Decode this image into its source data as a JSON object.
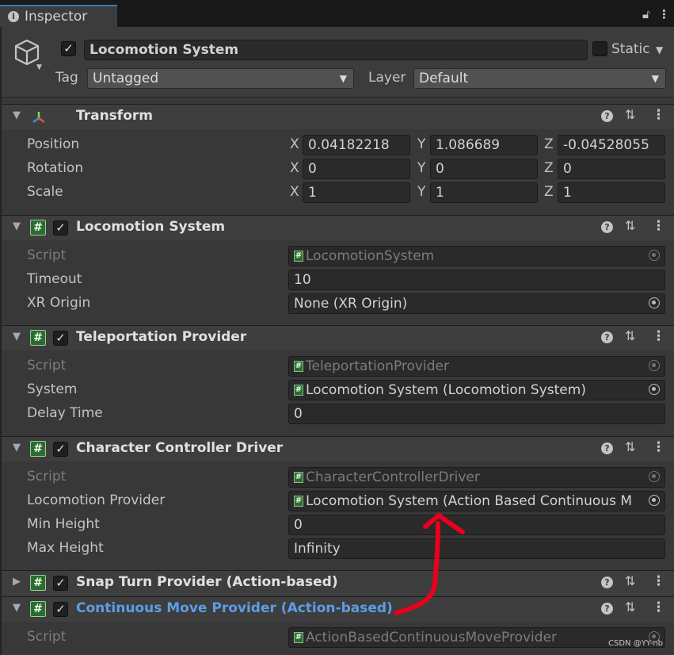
{
  "window": {
    "tab_title": "Inspector",
    "tab_icon": "info-icon"
  },
  "object": {
    "name": "Locomotion System",
    "active": true,
    "static_label": "Static",
    "static_checked": false,
    "tag_label": "Tag",
    "tag_value": "Untagged",
    "layer_label": "Layer",
    "layer_value": "Default"
  },
  "transform": {
    "title": "Transform",
    "position": {
      "label": "Position",
      "x": "0.04182218",
      "y": "1.086689",
      "z": "-0.04528055"
    },
    "rotation": {
      "label": "Rotation",
      "x": "0",
      "y": "0",
      "z": "0"
    },
    "scale": {
      "label": "Scale",
      "x": "1",
      "y": "1",
      "z": "1"
    },
    "axis": {
      "x": "X",
      "y": "Y",
      "z": "Z"
    }
  },
  "locomotion_system": {
    "title": "Locomotion System",
    "script_label": "Script",
    "script_value": "LocomotionSystem",
    "timeout_label": "Timeout",
    "timeout_value": "10",
    "xr_origin_label": "XR Origin",
    "xr_origin_value": "None (XR Origin)"
  },
  "teleportation_provider": {
    "title": "Teleportation Provider",
    "script_label": "Script",
    "script_value": "TeleportationProvider",
    "system_label": "System",
    "system_value": "Locomotion System (Locomotion System)",
    "delay_label": "Delay Time",
    "delay_value": "0"
  },
  "character_controller_driver": {
    "title": "Character Controller Driver",
    "script_label": "Script",
    "script_value": "CharacterControllerDriver",
    "provider_label": "Locomotion Provider",
    "provider_value": "Locomotion System (Action Based Continuous M",
    "min_label": "Min Height",
    "min_value": "0",
    "max_label": "Max Height",
    "max_value": "Infinity"
  },
  "snap_turn_provider": {
    "title": "Snap Turn Provider (Action-based)"
  },
  "continuous_move_provider": {
    "title": "Continuous Move Provider (Action-based)",
    "script_label": "Script",
    "script_value": "ActionBasedContinuousMoveProvider"
  },
  "colors": {
    "highlight_title": "#5c9ee6",
    "annotation_arrow": "#e8001c",
    "script_icon": "#2e6b31"
  },
  "watermark": "CSDN @YY-nb"
}
